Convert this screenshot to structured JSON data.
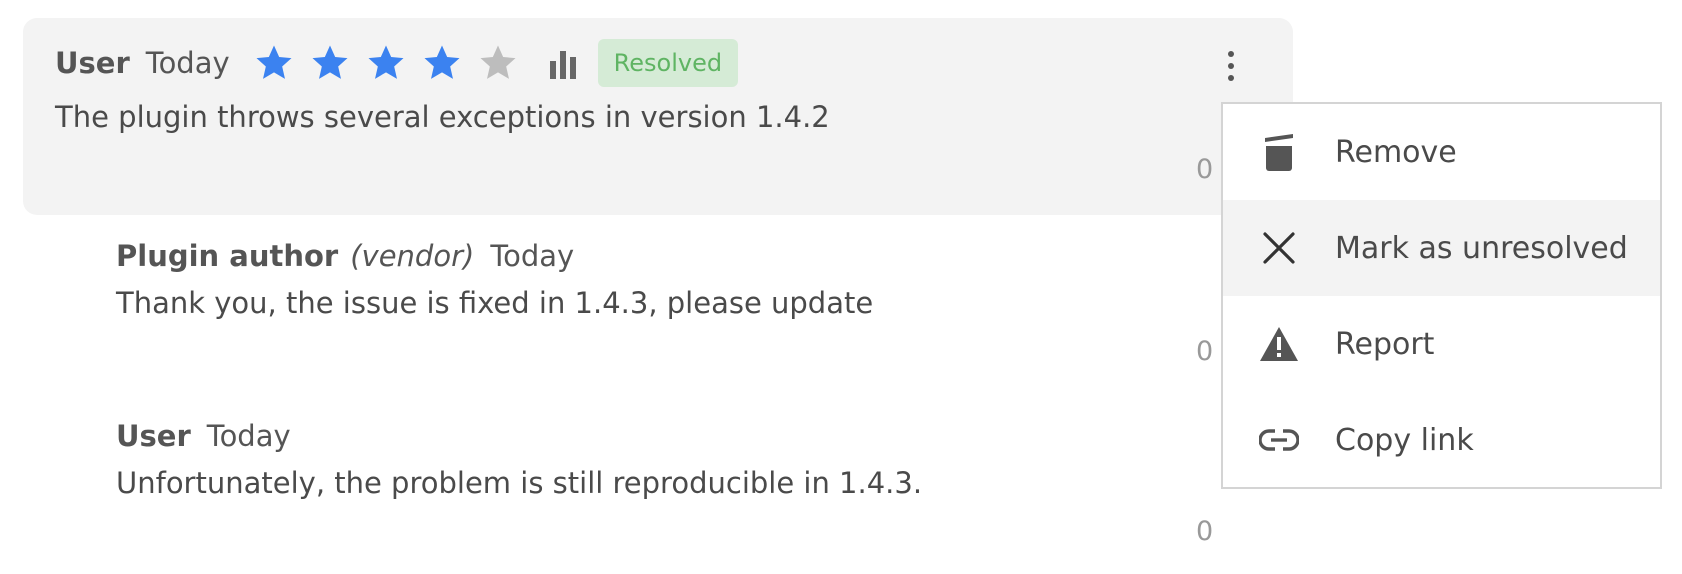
{
  "review": {
    "author": "User",
    "date": "Today",
    "rating": 4,
    "rating_max": 5,
    "stats_icon": "bar-chart-icon",
    "status": "Resolved",
    "text": "The plugin throws several exceptions in version 1.4.2",
    "count": "0",
    "menu_icon": "kebab-menu-icon"
  },
  "replies": [
    {
      "author": "Plugin author",
      "role": "(vendor)",
      "date": "Today",
      "text": "Thank you, the issue is fixed in 1.4.3, please update",
      "count": "0"
    },
    {
      "author": "User",
      "date": "Today",
      "text": "Unfortunately, the problem is still reproducible in 1.4.3.",
      "count": "0"
    }
  ],
  "menu": {
    "items": [
      {
        "label": "Remove",
        "icon": "trash-icon"
      },
      {
        "label": "Mark as unresolved",
        "icon": "close-icon",
        "highlighted": true
      },
      {
        "label": "Report",
        "icon": "warning-icon"
      },
      {
        "label": "Copy link",
        "icon": "link-icon"
      }
    ]
  },
  "colors": {
    "star_filled": "#3b82f0",
    "star_empty": "#bdbdbd",
    "badge_bg": "#d5ebd6",
    "badge_text": "#5fb463",
    "card_bg": "#f3f3f3"
  }
}
